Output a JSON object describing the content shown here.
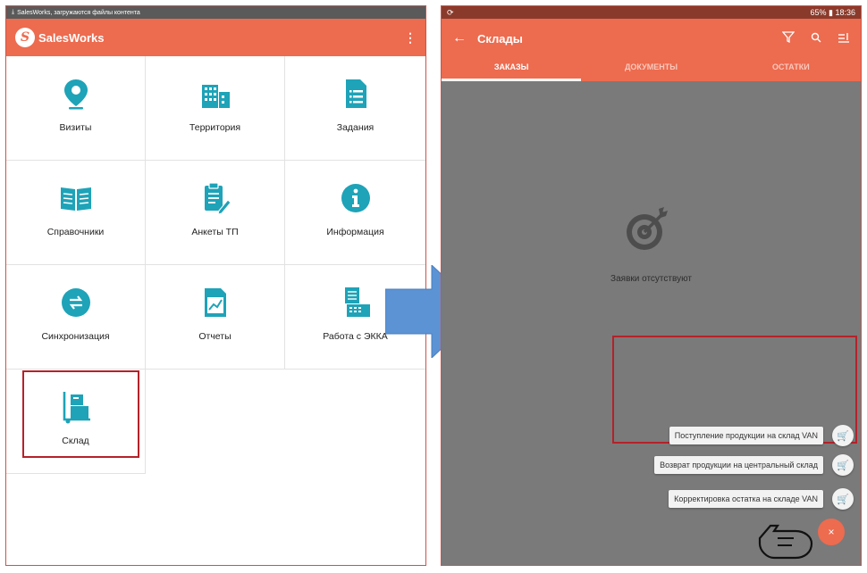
{
  "left": {
    "status_text": "SalesWorks, загружаются файлы контента",
    "app_title": "SalesWorks",
    "menu_icon": "⋮",
    "tiles": [
      {
        "label": "Визиты"
      },
      {
        "label": "Территория"
      },
      {
        "label": "Задания"
      },
      {
        "label": "Справочники"
      },
      {
        "label": "Анкеты ТП"
      },
      {
        "label": "Информация"
      },
      {
        "label": "Синхронизация"
      },
      {
        "label": "Отчеты"
      },
      {
        "label": "Работа с ЭККА"
      },
      {
        "label": "Склад"
      }
    ]
  },
  "right": {
    "status_left": "⟳",
    "status_right": "65% ▮ 18:36",
    "title": "Склады",
    "tabs": [
      {
        "label": "ЗАКАЗЫ"
      },
      {
        "label": "ДОКУМЕНТЫ"
      },
      {
        "label": "ОСТАТКИ"
      }
    ],
    "empty_text": "Заявки отсутствуют",
    "fab_actions": [
      {
        "label": "Поступление продукции на склад VAN"
      },
      {
        "label": "Возврат продукции на центральный склад"
      },
      {
        "label": "Корректировка остатка на складе VAN"
      }
    ],
    "main_fab_icon": "×"
  },
  "colors": {
    "accent": "#ed6b4f",
    "icon_teal": "#1ea3b8",
    "highlight": "#b5222a",
    "arrow": "#5b93d4"
  }
}
